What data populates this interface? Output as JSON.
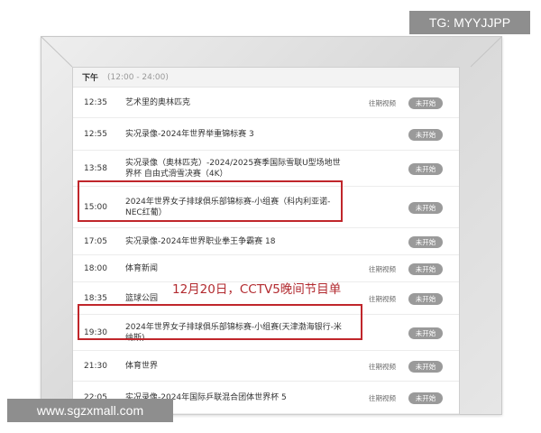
{
  "watermark_top": "TG: MYYJJPP",
  "watermark_bottom": "www.sgzxmall.com",
  "section": {
    "label": "下午",
    "range": "(12:00 - 24:00)"
  },
  "annotation": "12月20日，CCTV5晚间节目单",
  "programs": [
    {
      "time": "12:35",
      "title": "艺术里的奥林匹克",
      "replay": "往期视频",
      "status": "未开始"
    },
    {
      "time": "12:55",
      "title": "实况录像-2024年世界举重锦标赛 3",
      "replay": "",
      "status": "未开始"
    },
    {
      "time": "13:58",
      "title": "实况录像（奥林匹克）-2024/2025赛季国际雪联U型场地世界杯 自由式滑雪决赛（4K）",
      "replay": "",
      "status": "未开始"
    },
    {
      "time": "15:00",
      "title": "2024年世界女子排球俱乐部锦标赛-小组赛（科内利亚诺-NEC红葡）",
      "replay": "",
      "status": "未开始"
    },
    {
      "time": "17:05",
      "title": "实况录像-2024年世界职业拳王争霸赛 18",
      "replay": "",
      "status": "未开始"
    },
    {
      "time": "18:00",
      "title": "体育新闻",
      "replay": "往期视频",
      "status": "未开始"
    },
    {
      "time": "18:35",
      "title": "篮球公园",
      "replay": "往期视频",
      "status": "未开始"
    },
    {
      "time": "19:30",
      "title": "2024年世界女子排球俱乐部锦标赛-小组赛(天津渤海银行-米纳斯)",
      "replay": "",
      "status": "未开始"
    },
    {
      "time": "21:30",
      "title": "体育世界",
      "replay": "往期视频",
      "status": "未开始"
    },
    {
      "time": "22:05",
      "title": "实况录像-2024年国际乒联混合团体世界杯 5",
      "replay": "往期视频",
      "status": "未开始"
    }
  ]
}
